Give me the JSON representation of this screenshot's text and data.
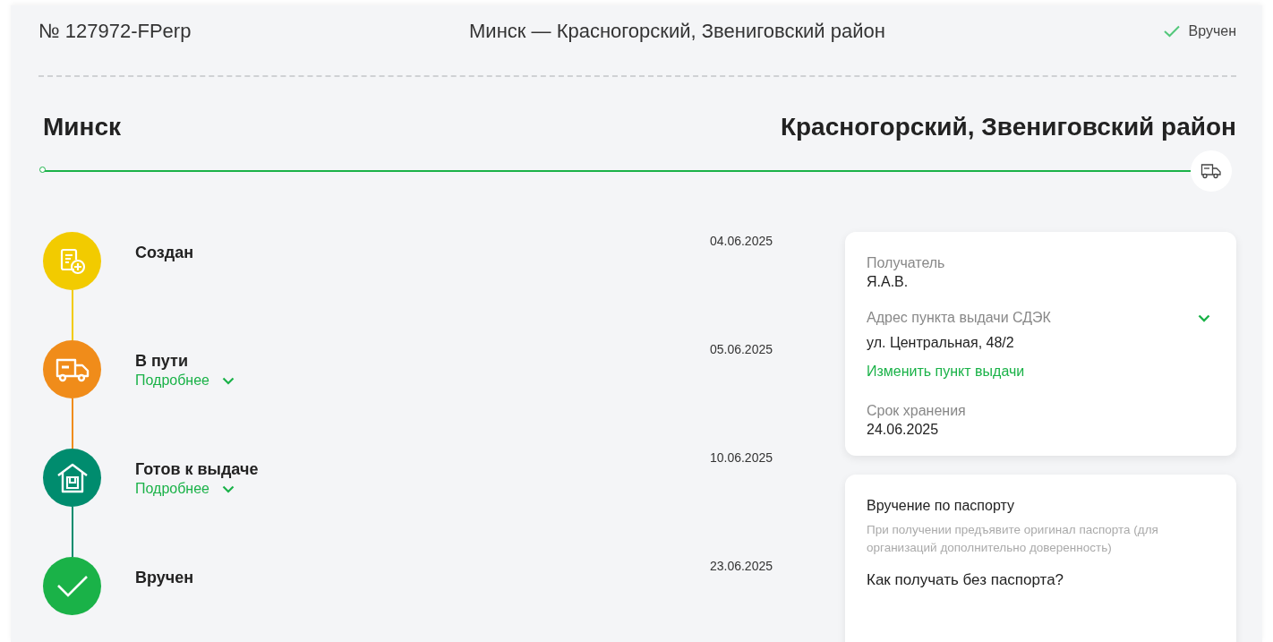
{
  "header": {
    "order_number": "№ 127972-FPerp",
    "route": "Минск — Красногорский, Звениговский район",
    "status": "Вручен"
  },
  "route": {
    "from": "Минск",
    "to": "Красногорский, Звениговский район"
  },
  "steps": [
    {
      "kind": "created",
      "title": "Создан",
      "date": "04.06.2025",
      "color": "#f2cb00"
    },
    {
      "kind": "transit",
      "title": "В пути",
      "date": "05.06.2025",
      "color": "#f08c1a",
      "details": {
        "label": "Подробнее",
        "expanded": false
      }
    },
    {
      "kind": "ready",
      "title": "Готов к выдаче",
      "date": "10.06.2025",
      "color": "#008c6e",
      "details": {
        "label": "Подробнее",
        "expanded": false
      }
    },
    {
      "kind": "delivered",
      "title": "Вручен",
      "date": "23.06.2025",
      "color": "#1ab248"
    }
  ],
  "info_card": {
    "recipient_label": "Получатель",
    "recipient": "Я.А.В.",
    "address_label": "Адрес пункта выдачи СДЭК",
    "address_expanded": false,
    "address": "ул. Центральная, 48/2",
    "change_link": "Изменить пункт выдачи",
    "storage_label": "Срок хранения",
    "storage_until": "24.06.2025"
  },
  "passport_card": {
    "title": "Вручение по паспорту",
    "note": "При получении предъявите оригинал паспорта (для организаций дополнительно доверенность)",
    "question": "Как получать без паспорта?"
  }
}
